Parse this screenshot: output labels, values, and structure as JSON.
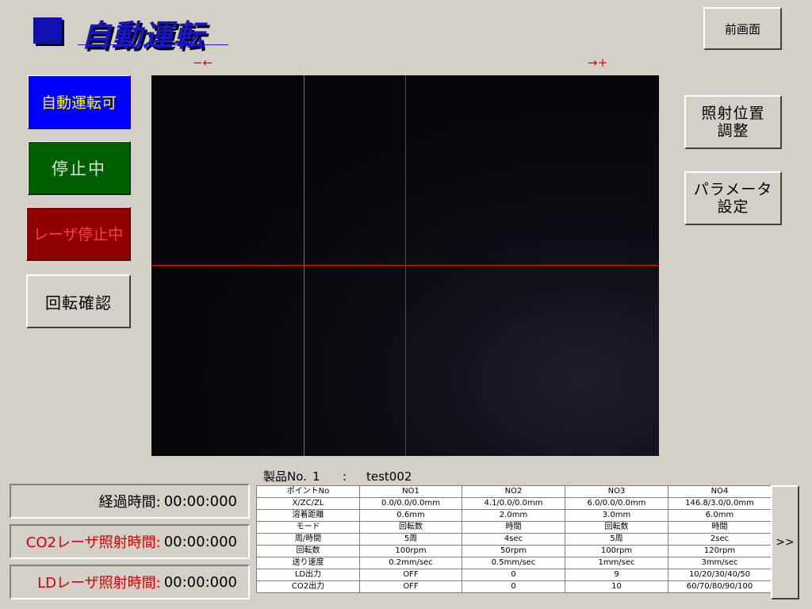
{
  "title": "自動運転",
  "header": {
    "prev_screen": "前画面"
  },
  "direction": {
    "minus": "−←",
    "plus": "→+"
  },
  "status": {
    "auto_ready": "自動運転可",
    "stopped": "停止中",
    "laser_stopped": "レーザ停止中",
    "rotation_check": "回転確認"
  },
  "right_buttons": {
    "irradiation_position": [
      "照射位置",
      "調整"
    ],
    "parameter_setting": [
      "パラメータ",
      "設定"
    ]
  },
  "product": {
    "label": "製品No.",
    "number": "1",
    "separator": ":",
    "name": "test002"
  },
  "timers": [
    {
      "label": "経過時間:",
      "value": "00:00:000",
      "label_color": "#000000"
    },
    {
      "label": "CO2レーザ照射時間:",
      "value": "00:00:000",
      "label_color": "#d00000"
    },
    {
      "label": "LDレーザ照射時間:",
      "value": "00:00:000",
      "label_color": "#d00000"
    }
  ],
  "table": {
    "header": [
      "ポイントNo",
      "NO1",
      "NO2",
      "NO3",
      "NO4"
    ],
    "rows": [
      [
        "X/ZC/ZL",
        "0.0/0.0/0.0mm",
        "4.1/0.0/0.0mm",
        "6.0/0.0/0.0mm",
        "146.8/3.0/0.0mm"
      ],
      [
        "溶着距離",
        "0.6mm",
        "2.0mm",
        "3.0mm",
        "6.0mm"
      ],
      [
        "モード",
        "回転数",
        "時間",
        "回転数",
        "時間"
      ],
      [
        "周/時間",
        "5周",
        "4sec",
        "5周",
        "2sec"
      ],
      [
        "回転数",
        "100rpm",
        "50rpm",
        "100rpm",
        "120rpm"
      ],
      [
        "送り速度",
        "0.2mm/sec",
        "0.5mm/sec",
        "1mm/sec",
        "3mm/sec"
      ],
      [
        "LD出力",
        "OFF",
        "0",
        "9",
        "10/20/30/40/50"
      ],
      [
        "CO2出力",
        "OFF",
        "0",
        "10",
        "60/70/80/90/100"
      ]
    ]
  },
  "next_label": ">>",
  "colors": {
    "background": "#d4d0c8",
    "title": "#1a14c8",
    "auto_ready_bg": "#0000ff",
    "auto_ready_text": "#ffff00",
    "stopped_bg": "#006000",
    "laser_stopped_bg": "#900000",
    "laser_stopped_text": "#ff4040",
    "crosshair_red": "#ff0000",
    "crosshair_green": "#00c000"
  }
}
